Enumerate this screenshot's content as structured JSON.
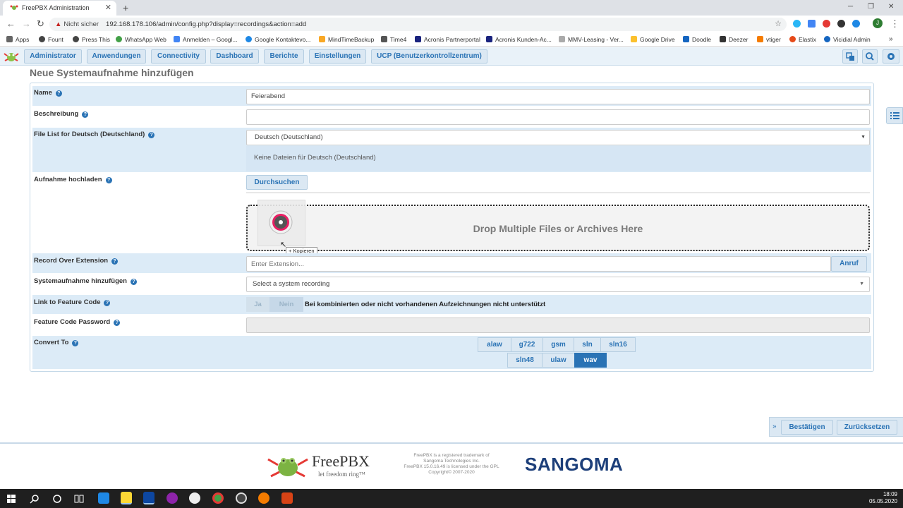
{
  "browser": {
    "tab_title": "FreePBX Administration",
    "not_secure": "Nicht sicher",
    "url": "192.168.178.106/admin/config.php?display=recordings&action=add",
    "bookmarks": [
      "Apps",
      "Fount",
      "Press This",
      "WhatsApp Web",
      "Anmelden – Googl...",
      "Google Kontaktevo...",
      "MindTimeBackup",
      "Time4",
      "Acronis Partnerportal",
      "Acronis Kunden-Ac...",
      "MMV-Leasing - Ver...",
      "Google Drive",
      "Doodle",
      "Deezer",
      "vtiger",
      "Elastix",
      "Vicidial Admin"
    ],
    "profile_initial": "J"
  },
  "nav": {
    "items": [
      "Administrator",
      "Anwendungen",
      "Connectivity",
      "Dashboard",
      "Berichte",
      "Einstellungen",
      "UCP (Benutzerkontrollzentrum)"
    ]
  },
  "page": {
    "title": "Neue Systemaufnahme hinzufügen",
    "name_label": "Name",
    "name_value": "Feierabend",
    "desc_label": "Beschreibung",
    "desc_value": "",
    "filelist_label": "File List for Deutsch (Deutschland)",
    "filelist_select": "Deutsch (Deutschland)",
    "filelist_empty": "Keine Dateien für Deutsch (Deutschland)",
    "upload_label": "Aufnahme hochladen",
    "browse_button": "Durchsuchen",
    "dropzone_text": "Drop Multiple Files or Archives Here",
    "copy_tooltip": "+ Kopieren",
    "record_label": "Record Over Extension",
    "record_placeholder": "Enter Extension...",
    "call_button": "Anruf",
    "sysrec_label": "Systemaufnahme hinzufügen",
    "sysrec_select": "Select a system recording",
    "link_label": "Link to Feature Code",
    "link_yes": "Ja",
    "link_no": "Nein",
    "link_note": "Bei kombinierten oder nicht vorhandenen Aufzeichnungen nicht unterstützt",
    "fcpass_label": "Feature Code Password",
    "convert_label": "Convert To",
    "convert_row1": [
      "alaw",
      "g722",
      "gsm",
      "sln",
      "sln16"
    ],
    "convert_row2": [
      "sln48",
      "ulaw",
      "wav"
    ],
    "convert_selected": "wav",
    "submit_button": "Bestätigen",
    "reset_button": "Zurücksetzen"
  },
  "footer": {
    "freepbx_logo_text": "FreePBX",
    "freepbx_tagline": "let freedom ring™",
    "legal": [
      "FreePBX is a registered trademark of",
      "Sangoma Technologies Inc.",
      "FreePBX 15.0.16.49 is licensed under the GPL",
      "Copyright© 2007-2020"
    ],
    "sangoma_logo_text": "SANGOMA"
  },
  "taskbar": {
    "time": "18:09",
    "date": "05.05.2020"
  },
  "colors": {
    "accent": "#2a73b5",
    "row_bg": "#dcebf7",
    "warning": "#c5221f"
  }
}
